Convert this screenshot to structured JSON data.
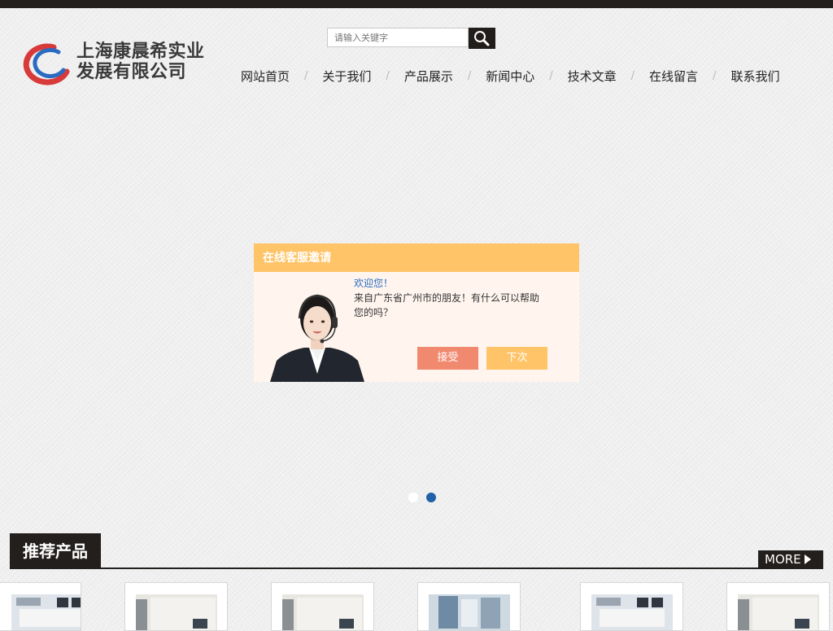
{
  "company": {
    "name_line1": "上海康晨希实业",
    "name_line2": "发展有限公司"
  },
  "search": {
    "placeholder": "请输入关键字"
  },
  "nav": {
    "items": [
      "网站首页",
      "关于我们",
      "产品展示",
      "新闻中心",
      "技术文章",
      "在线留言",
      "联系我们"
    ],
    "separator": "/"
  },
  "chat_popup": {
    "title": "在线客服邀请",
    "greeting": "欢迎您！",
    "message": "来自广东省广州市的朋友！有什么可以帮助您的吗？",
    "accept_label": "接受",
    "next_label": "下次"
  },
  "slider": {
    "dot_count": 2,
    "active_dot": 2
  },
  "recommended": {
    "title": "推荐产品",
    "more_label": "MORE"
  },
  "colors": {
    "dark": "#231f1c",
    "popup_header": "#ffc468",
    "accept_button": "#f1896f",
    "active_dot": "#2061a8",
    "logo_blue": "#2a6bc1",
    "logo_red": "#d83a3a"
  },
  "icons": {
    "search": "search-icon",
    "more": "triangle-right-icon"
  }
}
